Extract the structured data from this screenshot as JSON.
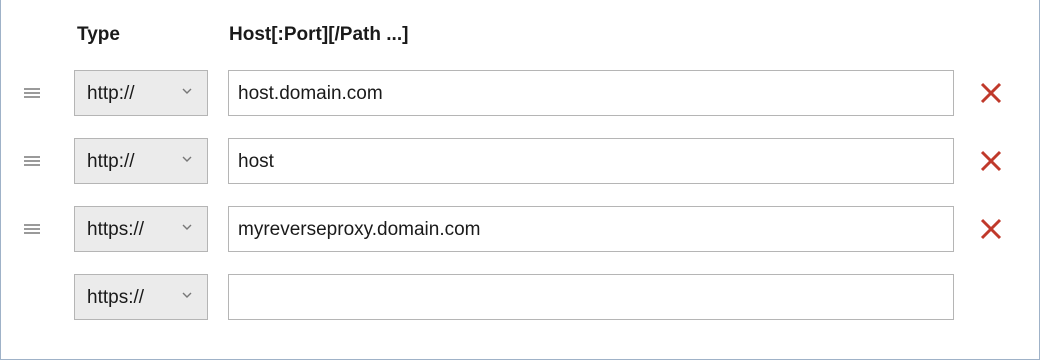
{
  "headers": {
    "type": "Type",
    "host": "Host[:Port][/Path ...]"
  },
  "rows": [
    {
      "type": "http://",
      "host": "host.domain.com",
      "has_handle": true,
      "has_delete": true
    },
    {
      "type": "http://",
      "host": "host",
      "has_handle": true,
      "has_delete": true
    },
    {
      "type": "https://",
      "host": "myreverseproxy.domain.com",
      "has_handle": true,
      "has_delete": true
    },
    {
      "type": "https://",
      "host": "",
      "has_handle": false,
      "has_delete": false
    }
  ],
  "icons": {
    "handle": "drag-handle-icon",
    "chevron": "chevron-down-icon",
    "delete": "close-icon"
  },
  "colors": {
    "delete": "#c0392b",
    "border": "#b5b5b5",
    "select_bg": "#ebebeb"
  }
}
